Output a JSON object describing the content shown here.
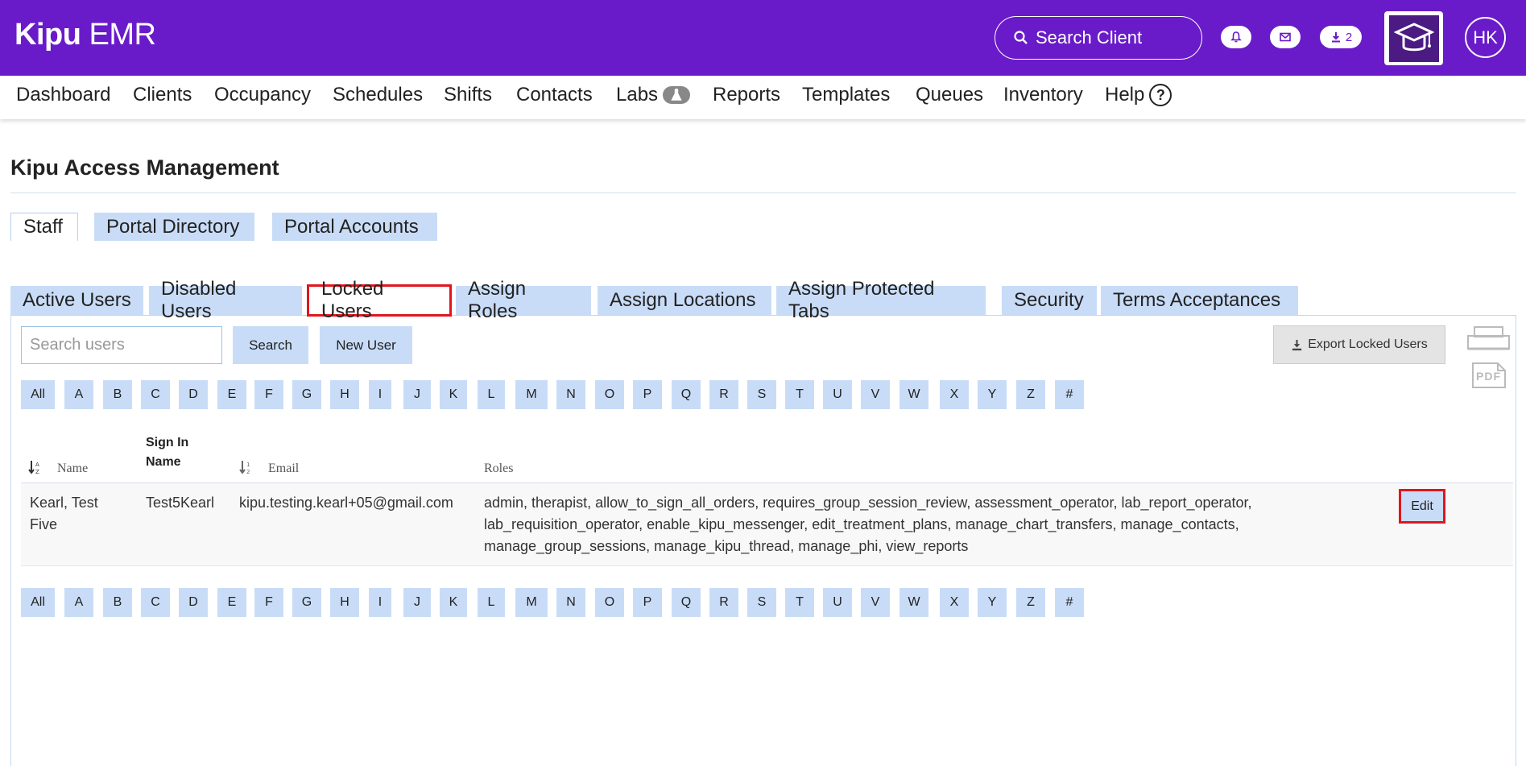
{
  "app": {
    "brand_bold": "Kipu",
    "brand_light": " EMR",
    "search_client": "Search Client",
    "download_count": "2",
    "avatar_initials": "HK"
  },
  "nav": {
    "items": [
      "Dashboard",
      "Clients",
      "Occupancy",
      "Schedules",
      "Shifts",
      "Contacts",
      "Labs",
      "Reports",
      "Templates",
      "Queues",
      "Inventory",
      "Help"
    ]
  },
  "page": {
    "title": "Kipu Access Management",
    "top_tabs": [
      "Staff",
      "Portal Directory",
      "Portal Accounts"
    ],
    "sub_tabs": [
      "Active Users",
      "Disabled Users",
      "Locked Users",
      "Assign Roles",
      "Assign Locations",
      "Assign Protected Tabs",
      "Security",
      "Terms Acceptances"
    ]
  },
  "toolbar": {
    "search_placeholder": "Search users",
    "search_label": "Search",
    "new_user_label": "New User",
    "export_label": "Export Locked Users",
    "pdf_label": "PDF"
  },
  "letters": [
    "All",
    "A",
    "B",
    "C",
    "D",
    "E",
    "F",
    "G",
    "H",
    "I",
    "J",
    "K",
    "L",
    "M",
    "N",
    "O",
    "P",
    "Q",
    "R",
    "S",
    "T",
    "U",
    "V",
    "W",
    "X",
    "Y",
    "Z",
    "#"
  ],
  "table": {
    "headers": {
      "name": "Name",
      "sign_in_line1": "Sign In",
      "sign_in_line2": "Name",
      "email": "Email",
      "roles": "Roles"
    },
    "rows": [
      {
        "name_line1": "Kearl, Test",
        "name_line2": "Five",
        "sign_in": "Test5Kearl",
        "email": "kipu.testing.kearl+05@gmail.com",
        "roles_line1": "admin, therapist, allow_to_sign_all_orders, requires_group_session_review, assessment_operator, lab_report_operator,",
        "roles_line2": "lab_requisition_operator, enable_kipu_messenger, edit_treatment_plans, manage_chart_transfers, manage_contacts,",
        "roles_line3": "manage_group_sessions, manage_kipu_thread, manage_phi, view_reports",
        "edit_label": "Edit"
      }
    ]
  }
}
